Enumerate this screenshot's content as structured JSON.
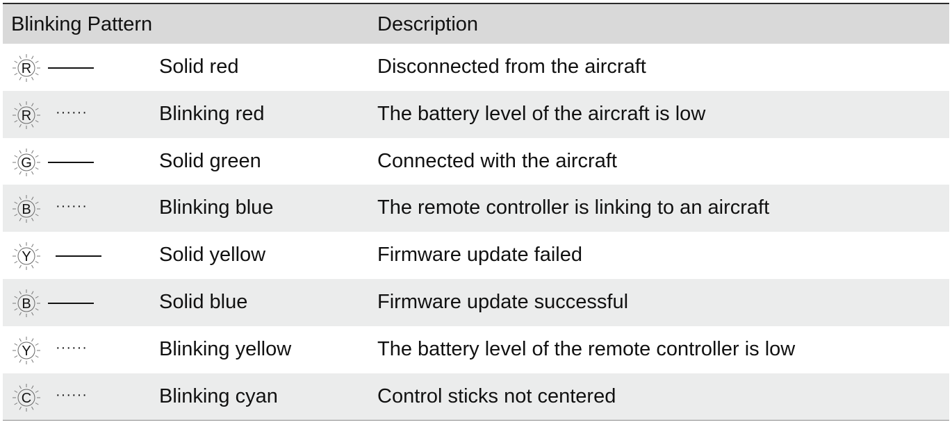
{
  "table": {
    "headers": {
      "pattern": "Blinking Pattern",
      "description": "Description"
    },
    "rows": [
      {
        "letter": "R",
        "style": "solid",
        "pattern": "Solid red",
        "description": "Disconnected from the aircraft"
      },
      {
        "letter": "R",
        "style": "dots",
        "pattern": "Blinking red",
        "description": "The battery level of the aircraft is low"
      },
      {
        "letter": "G",
        "style": "solid",
        "pattern": "Solid green",
        "description": "Connected with the aircraft"
      },
      {
        "letter": "B",
        "style": "dots",
        "pattern": "Blinking blue",
        "description": "The remote controller is linking to an aircraft"
      },
      {
        "letter": "Y",
        "style": "solid",
        "pattern": "Solid yellow",
        "description": "Firmware update failed"
      },
      {
        "letter": "B",
        "style": "solid",
        "pattern": "Solid blue",
        "description": "Firmware update successful"
      },
      {
        "letter": "Y",
        "style": "dots",
        "pattern": "Blinking yellow",
        "description": "The battery level of the remote controller is low"
      },
      {
        "letter": "C",
        "style": "dots",
        "pattern": "Blinking cyan",
        "description": "Control sticks not centered"
      }
    ],
    "dots_glyph": "······"
  }
}
